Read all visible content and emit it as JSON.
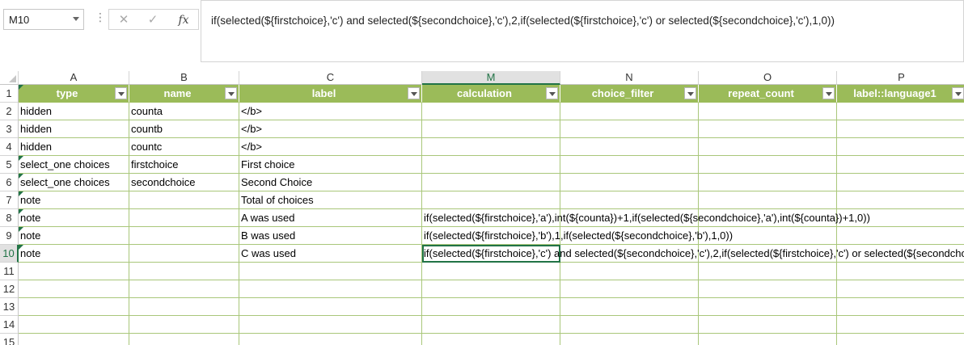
{
  "name_box": {
    "value": "M10"
  },
  "formula_bar": {
    "cancel_glyph": "✕",
    "enter_glyph": "✓",
    "fx_label": "fx",
    "formula": "if(selected(${firstchoice},'c') and selected(${secondchoice},'c'),2,if(selected(${firstchoice},'c') or selected(${secondchoice},'c'),1,0))"
  },
  "columns": [
    {
      "letter": "A",
      "header": "type"
    },
    {
      "letter": "B",
      "header": "name"
    },
    {
      "letter": "C",
      "header": "label"
    },
    {
      "letter": "M",
      "header": "calculation"
    },
    {
      "letter": "N",
      "header": "choice_filter"
    },
    {
      "letter": "O",
      "header": "repeat_count"
    },
    {
      "letter": "P",
      "header": "label::language1"
    }
  ],
  "rows": [
    {
      "num": "1"
    },
    {
      "num": "2",
      "type": "hidden",
      "name": "counta",
      "label": "</b>",
      "calculation": ""
    },
    {
      "num": "3",
      "type": "hidden",
      "name": "countb",
      "label": "</b>",
      "calculation": ""
    },
    {
      "num": "4",
      "type": "hidden",
      "name": "countc",
      "label": "</b>",
      "calculation": ""
    },
    {
      "num": "5",
      "type": "select_one choices",
      "name": "firstchoice",
      "label": "First choice",
      "calculation": ""
    },
    {
      "num": "6",
      "type": "select_one choices",
      "name": "secondchoice",
      "label": "Second Choice",
      "calculation": ""
    },
    {
      "num": "7",
      "type": "note",
      "name": "",
      "label": "Total of choices",
      "calculation": ""
    },
    {
      "num": "8",
      "type": "note",
      "name": "",
      "label": "A was used",
      "calculation": "if(selected(${firstchoice},'a'),int(${counta})+1,if(selected(${secondchoice},'a'),int(${counta})+1,0))"
    },
    {
      "num": "9",
      "type": "note",
      "name": "",
      "label": "B was used",
      "calculation": "if(selected(${firstchoice},'b'),1,if(selected(${secondchoice},'b'),1,0))"
    },
    {
      "num": "10",
      "type": "note",
      "name": "",
      "label": "C was used",
      "calculation": "if(selected(${firstchoice},'c') and selected(${secondchoice},'c'),2,if(selected(${firstchoice},'c') or selected(${secondchoice},'c'),1,0))"
    },
    {
      "num": "11"
    },
    {
      "num": "12"
    },
    {
      "num": "13"
    },
    {
      "num": "14"
    },
    {
      "num": "15"
    }
  ],
  "colors": {
    "header_fill": "#9bbb59",
    "gridline": "#a9c77a",
    "selection": "#217346"
  }
}
